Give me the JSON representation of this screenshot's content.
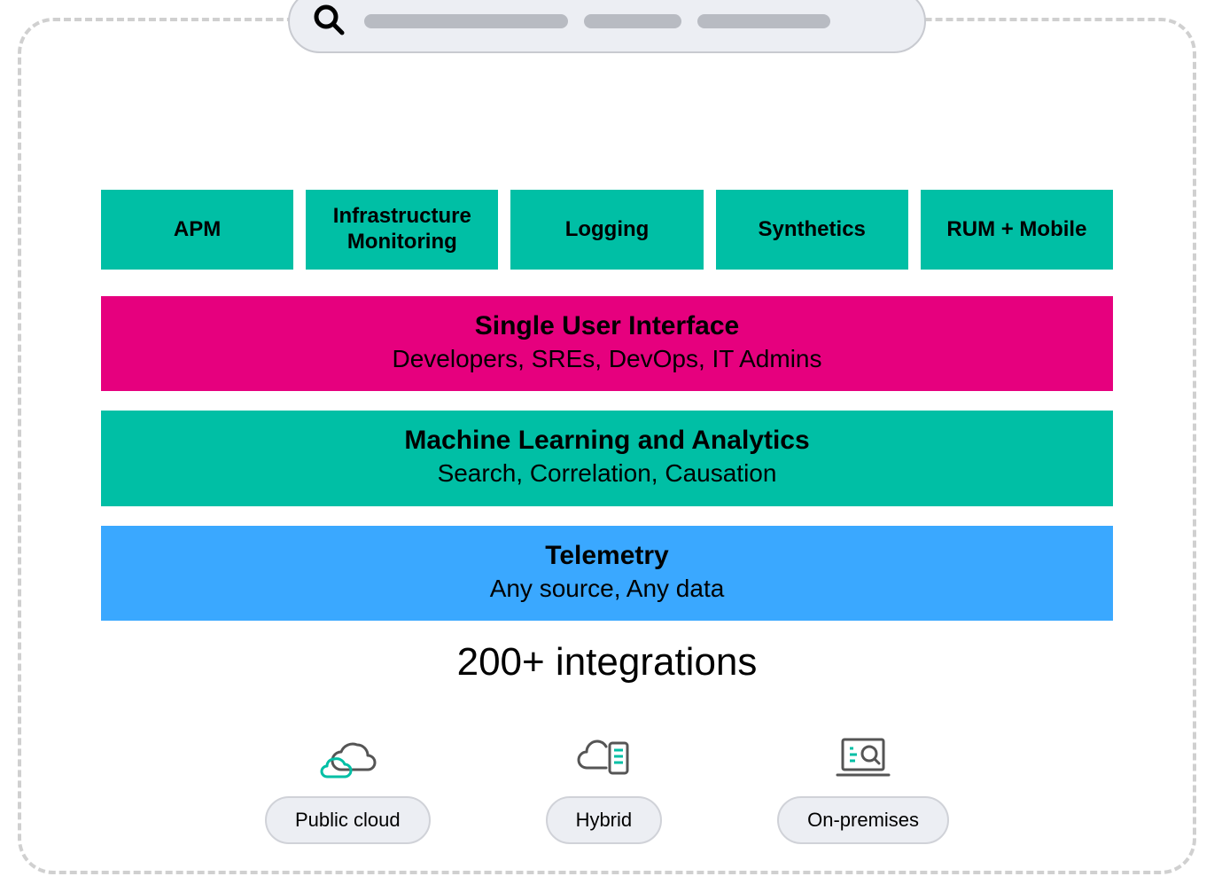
{
  "products": {
    "apm": "APM",
    "infra": "Infrastructure Monitoring",
    "logging": "Logging",
    "synthetics": "Synthetics",
    "rum": "RUM + Mobile"
  },
  "layers": {
    "ui": {
      "title": "Single User Interface",
      "subtitle": "Developers, SREs, DevOps, IT Admins"
    },
    "ml": {
      "title": "Machine Learning and Analytics",
      "subtitle": "Search, Correlation, Causation"
    },
    "telemetry": {
      "title": "Telemetry",
      "subtitle": "Any source, Any data"
    }
  },
  "integrations": "200+ integrations",
  "deployment": {
    "public_cloud": "Public cloud",
    "hybrid": "Hybrid",
    "on_premises": "On-premises"
  },
  "colors": {
    "teal": "#00bfa5",
    "pink": "#e6007e",
    "blue": "#3aa8ff",
    "grey_bg": "#eceef3",
    "grey_border": "#d0d0d0"
  }
}
